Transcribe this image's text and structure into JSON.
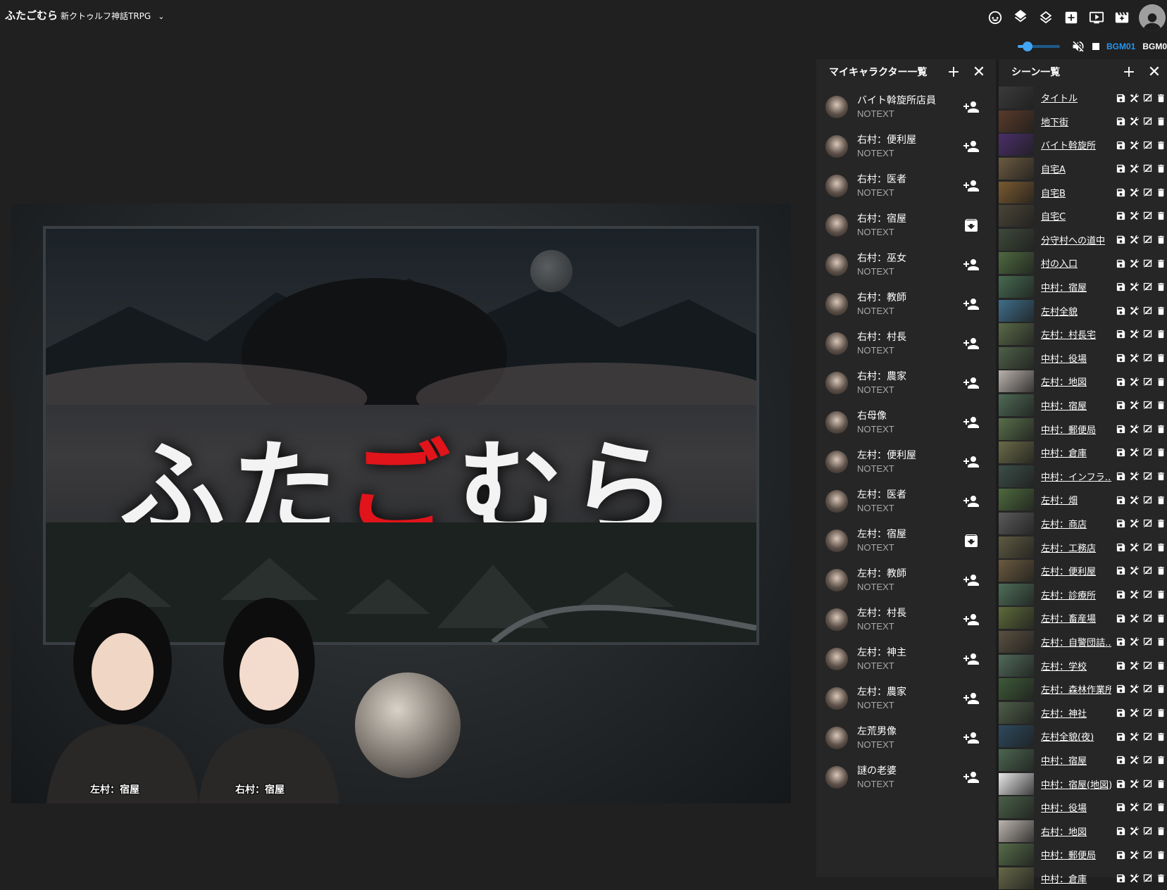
{
  "room": {
    "name": "ふたごむら",
    "system": "新クトゥルフ神話TRPG",
    "chevron": "⌄"
  },
  "bgm": {
    "tabs": [
      "BGM01",
      "BGM0"
    ],
    "volume": 0.24
  },
  "stage": {
    "title_parts": [
      "ふた",
      "ご",
      "むら"
    ],
    "character_labels": [
      "左村：宿屋",
      "右村：宿屋"
    ]
  },
  "char_panel": {
    "title": "マイキャラクター一覧",
    "items": [
      {
        "name": "バイト斡旋所店員",
        "sub": "NOTEXT",
        "action": "add-person"
      },
      {
        "name": "右村：便利屋",
        "sub": "NOTEXT",
        "action": "add-person"
      },
      {
        "name": "右村：医者",
        "sub": "NOTEXT",
        "action": "add-person"
      },
      {
        "name": "右村：宿屋",
        "sub": "NOTEXT",
        "action": "unarchive"
      },
      {
        "name": "右村：巫女",
        "sub": "NOTEXT",
        "action": "add-person"
      },
      {
        "name": "右村：教師",
        "sub": "NOTEXT",
        "action": "add-person"
      },
      {
        "name": "右村：村長",
        "sub": "NOTEXT",
        "action": "add-person"
      },
      {
        "name": "右村：農家",
        "sub": "NOTEXT",
        "action": "add-person"
      },
      {
        "name": "右母像",
        "sub": "NOTEXT",
        "action": "add-person"
      },
      {
        "name": "左村：便利屋",
        "sub": "NOTEXT",
        "action": "add-person"
      },
      {
        "name": "左村：医者",
        "sub": "NOTEXT",
        "action": "add-person"
      },
      {
        "name": "左村：宿屋",
        "sub": "NOTEXT",
        "action": "unarchive"
      },
      {
        "name": "左村：教師",
        "sub": "NOTEXT",
        "action": "add-person"
      },
      {
        "name": "左村：村長",
        "sub": "NOTEXT",
        "action": "add-person"
      },
      {
        "name": "左村：神主",
        "sub": "NOTEXT",
        "action": "add-person"
      },
      {
        "name": "左村：農家",
        "sub": "NOTEXT",
        "action": "add-person"
      },
      {
        "name": "左荒男像",
        "sub": "NOTEXT",
        "action": "add-person"
      },
      {
        "name": "謎の老婆",
        "sub": "NOTEXT",
        "action": "add-person"
      }
    ]
  },
  "scene_panel": {
    "title": "シーン一覧",
    "items": [
      {
        "name": "タイトル",
        "color": "#3b3b3b"
      },
      {
        "name": "地下街",
        "color": "#5a3a2a"
      },
      {
        "name": "バイト斡旋所",
        "color": "#4b2f6a"
      },
      {
        "name": "自宅A",
        "color": "#6b5a40"
      },
      {
        "name": "自宅B",
        "color": "#7a5a30"
      },
      {
        "name": "自宅C",
        "color": "#4a4538"
      },
      {
        "name": "分守村への道中",
        "color": "#3e4a3a"
      },
      {
        "name": "村の入口",
        "color": "#4e6a40"
      },
      {
        "name": "中村：宿屋",
        "color": "#466a50"
      },
      {
        "name": "左村全貌",
        "color": "#3f6e8a"
      },
      {
        "name": "左村：村長宅",
        "color": "#5a6a48"
      },
      {
        "name": "中村：役場",
        "color": "#4e6048"
      },
      {
        "name": "左村：地図",
        "color": "#b9b2ac"
      },
      {
        "name": "中村：宿屋",
        "color": "#4f6a55"
      },
      {
        "name": "中村：郵便局",
        "color": "#586e4a"
      },
      {
        "name": "中村：倉庫",
        "color": "#6a6a48"
      },
      {
        "name": "中村：インフラ…",
        "color": "#3c4e48"
      },
      {
        "name": "左村：畑",
        "color": "#4e6a3e"
      },
      {
        "name": "左村：商店",
        "color": "#5a5a5a"
      },
      {
        "name": "左村：工務店",
        "color": "#5e5a42"
      },
      {
        "name": "左村：便利屋",
        "color": "#6a5a3e"
      },
      {
        "name": "左村：診療所",
        "color": "#4e6e58"
      },
      {
        "name": "左村：畜産場",
        "color": "#5e6a3a"
      },
      {
        "name": "左村：自警団詰…",
        "color": "#5a5040"
      },
      {
        "name": "左村：学校",
        "color": "#506a5a"
      },
      {
        "name": "左村：森林作業所",
        "color": "#3e5a38"
      },
      {
        "name": "左村：神社",
        "color": "#4e5e48"
      },
      {
        "name": "左村全貌(夜)",
        "color": "#2e4a5e"
      },
      {
        "name": "中村：宿屋",
        "color": "#4c6650"
      },
      {
        "name": "中村：宿屋(地図)",
        "color": "#e8e8e8"
      },
      {
        "name": "中村：役場",
        "color": "#4a6048"
      },
      {
        "name": "右村：地図",
        "color": "#bcb5ae"
      },
      {
        "name": "中村：郵便局",
        "color": "#566c4a"
      },
      {
        "name": "中村：倉庫",
        "color": "#666848"
      }
    ]
  }
}
